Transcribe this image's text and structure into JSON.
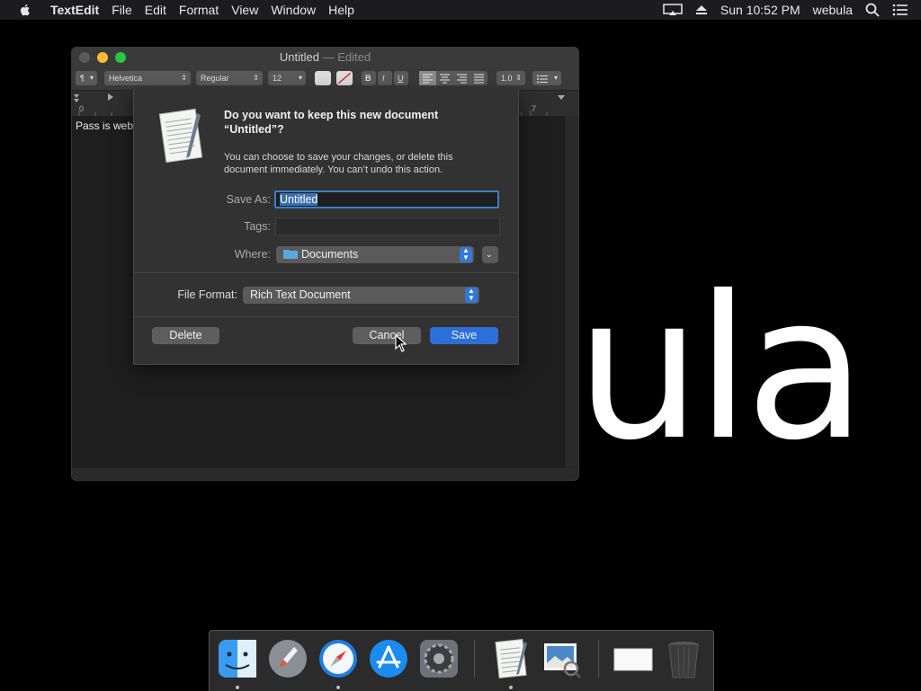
{
  "menubar": {
    "app_name": "TextEdit",
    "menus": [
      "File",
      "Edit",
      "Format",
      "View",
      "Window",
      "Help"
    ],
    "clock": "Sun 10:52 PM",
    "user": "webula"
  },
  "wallpaper_text": "ula",
  "window": {
    "title": "Untitled",
    "title_suffix": " — Edited",
    "toolbar": {
      "font_family": "Helvetica",
      "font_style": "Regular",
      "font_size": "12",
      "bold": "B",
      "italic": "I",
      "underline": "U",
      "line_spacing": "1.0"
    },
    "ruler": {
      "start": "0",
      "end": "7"
    },
    "document_text": "Pass is web"
  },
  "sheet": {
    "title": "Do you want to keep this new document “Untitled”?",
    "message": "You can choose to save your changes, or delete this document immediately. You can’t undo this action.",
    "save_as_label": "Save As:",
    "save_as_value": "Untitled",
    "tags_label": "Tags:",
    "where_label": "Where:",
    "where_value": "Documents",
    "file_format_label": "File Format:",
    "file_format_value": "Rich Text Document",
    "delete_label": "Delete",
    "cancel_label": "Cancel",
    "save_label": "Save"
  },
  "colors": {
    "accent": "#2c6fd8",
    "close": "#ff5f57",
    "minimize": "#febc2e",
    "zoom": "#28c840"
  }
}
